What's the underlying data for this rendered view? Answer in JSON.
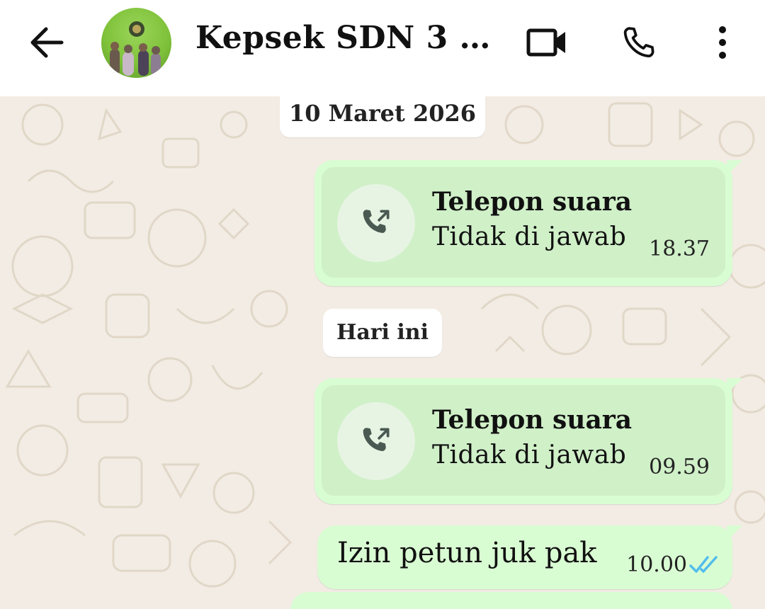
{
  "header": {
    "back_icon": "arrow-left-icon",
    "contact_name": "Kepsek SDN 3 Pa...",
    "video_icon": "video-camera-icon",
    "call_icon": "phone-icon",
    "menu_icon": "more-vertical-icon"
  },
  "chat": {
    "date_1": "10 Maret 2026",
    "call_1": {
      "title": "Telepon suara",
      "status": "Tidak di jawab",
      "time": "18.37",
      "icon": "outgoing-call-icon"
    },
    "date_2": "Hari ini",
    "call_2": {
      "title": "Telepon suara",
      "status": "Tidak di jawab",
      "time": "09.59",
      "icon": "outgoing-call-icon"
    },
    "message_1": {
      "text": "Izin petun juk pak",
      "time": "10.00",
      "status_icon": "double-check-read-icon"
    }
  },
  "colors": {
    "outgoing_bubble": "#d9fdd3",
    "wallpaper": "#f2ece4",
    "read_tick": "#53bdeb"
  }
}
